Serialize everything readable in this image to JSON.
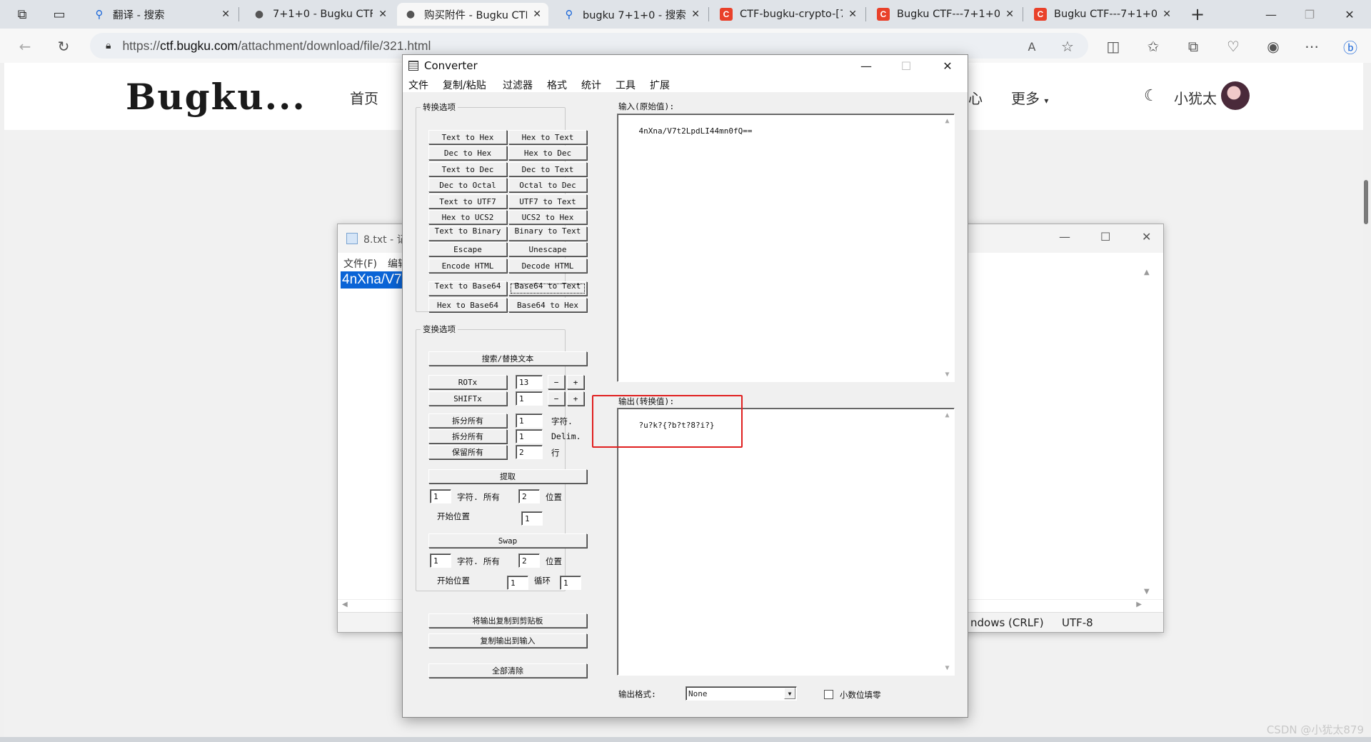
{
  "browser": {
    "tabs": [
      {
        "title": "翻译 - 搜索",
        "favicon": "search-icon"
      },
      {
        "title": "7+1+0 - Bugku CTF",
        "favicon": "github-icon"
      },
      {
        "title": "购买附件 - Bugku CTF",
        "favicon": "github-icon"
      },
      {
        "title": "bugku 7+1+0 - 搜索",
        "favicon": "search-icon"
      },
      {
        "title": "CTF-bugku-crypto-[7",
        "favicon": "csdn-icon"
      },
      {
        "title": "Bugku CTF---7+1+0",
        "favicon": "csdn-icon"
      },
      {
        "title": "Bugku CTF---7+1+0",
        "favicon": "csdn-icon"
      }
    ],
    "url_prefix": "https://",
    "url_domain": "ctf.bugku.com",
    "url_path": "/attachment/download/file/321.html"
  },
  "site": {
    "logo": "Bugku...",
    "nav_home": "首页",
    "nav_center_partial": "心",
    "nav_more": "更多",
    "user_name": "小犹太"
  },
  "notepad": {
    "title": "8.txt - 记",
    "menu_file": "文件(F)",
    "menu_edit": "编辑",
    "content": "4nXna/V7",
    "status_eol": "ndows (CRLF)",
    "status_encoding": "UTF-8"
  },
  "converter": {
    "title": "Converter",
    "menu": [
      "文件",
      "复制/粘贴",
      "过滤器",
      "格式",
      "统计",
      "工具",
      "扩展"
    ],
    "group_convert": "转换选项",
    "convert_buttons": [
      "Text to Hex",
      "Hex to Text",
      "Dec to Hex",
      "Hex to Dec",
      "Text to Dec",
      "Dec to Text",
      "Dec to Octal",
      "Octal to Dec",
      "Text to UTF7",
      "UTF7 to Text",
      "Hex to UCS2",
      "UCS2 to Hex",
      "Text to Binary",
      "Binary to Text",
      "Escape",
      "Unescape",
      "Encode HTML",
      "Decode HTML",
      "Text to Base64",
      "Base64 to Text",
      "Hex to Base64",
      "Base64 to Hex"
    ],
    "group_transform": "变换选项",
    "search_replace": "搜索/替换文本",
    "rotx_label": "ROTx",
    "rotx_value": "13",
    "shiftx_label": "SHIFTx",
    "shiftx_value": "1",
    "minus": "−",
    "plus": "+",
    "split_all_1": "拆分所有",
    "split_1_value": "1",
    "split_1_unit": "字符.",
    "split_all_2": "拆分所有",
    "split_2_value": "1",
    "split_2_unit": "Delim.",
    "keep_all": "保留所有",
    "keep_value": "2",
    "keep_unit": "行",
    "extract": "提取",
    "extract_chars_value": "1",
    "extract_chars_label": "字符. 所有",
    "extract_pos_value": "2",
    "extract_pos_label": "位置",
    "start_pos_label": "开始位置",
    "start_pos_value": "1",
    "swap": "Swap",
    "swap_chars_value": "1",
    "swap_chars_label": "字符. 所有",
    "swap_pos_value": "2",
    "swap_pos_label": "位置",
    "swap_start_label": "开始位置",
    "swap_start_value": "1",
    "swap_loop_label": "循环",
    "swap_loop_value": "1",
    "copy_to_clipboard": "将输出复制到剪贴板",
    "copy_output_to_input": "复制输出到输入",
    "clear_all": "全部清除",
    "input_label": "输入(原始值):",
    "input_value": "4nXna/V7t2LpdLI44mn0fQ==",
    "output_label": "输出(转换值):",
    "output_value": "?u?k?{?b?t?8?i?}",
    "output_format_label": "输出格式:",
    "output_format_value": "None",
    "decimal_pad_label": "小数位填零"
  },
  "watermark": "CSDN @小犹太879"
}
